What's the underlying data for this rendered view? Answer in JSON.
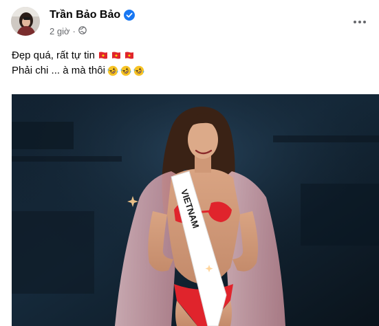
{
  "post": {
    "author": "Trần Bảo Bảo",
    "time": "2 giờ",
    "caption_line1": "Đẹp quá, rất tự tin",
    "caption_line2": "Phải chi ... à mà thôi",
    "emoji_line1": [
      "vietnam-flag",
      "vietnam-flag",
      "vietnam-flag"
    ],
    "emoji_line2": [
      "rolling-laughing",
      "rolling-laughing",
      "rolling-laughing"
    ],
    "sash_text": "VIETNAM"
  },
  "icons": {
    "verified": "verified-badge-icon",
    "audience": "globe-icon",
    "more": "more-options-icon"
  },
  "colors": {
    "verified_blue": "#1877f2",
    "meta_gray": "#65676b",
    "swimsuit_red": "#e0242c",
    "stage_dark": "#0f1b26"
  }
}
